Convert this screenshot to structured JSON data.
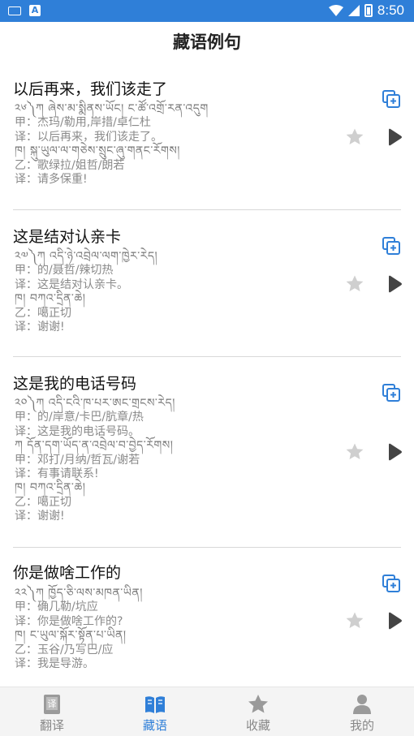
{
  "status": {
    "time": "8:50"
  },
  "header": {
    "title": "藏语例句"
  },
  "colors": {
    "accent": "#2f7fd8",
    "icon_gray": "#cfcfcf",
    "play": "#444444"
  },
  "entries": [
    {
      "title": "以后再来，我们该走了",
      "lines": [
        "༢༦༽ཀ  ཞེས་མ་སྨིནས་ཡོང།     ང་ཚོ་འགྲོ་རན་འདུག",
        "甲：杰玛/勒用,岸措/卓仁杜",
        "译：以后再来，我们该走了。",
        "ཁ།  སྐུ་ཡུལ་ལ་གཅེས་སྲུང་ཞུ་གནང་རོགས།",
        "乙：歌绿拉/姐哲/朗若",
        "译：请多保重!"
      ]
    },
    {
      "title": "这是结对认亲卡",
      "lines": [
        "༢༧༽ཀ  འདི་ཉེ་འབྲེལ་ལག་ཁྱེར་རེད།",
        "甲：的/聂哲/辣切热",
        "译：这是结对认亲卡。",
        "ཁ།  བཀའ་དྲིན་ཆེ།",
        "乙：噶正切",
        "译：谢谢!"
      ]
    },
    {
      "title": "这是我的电话号码",
      "lines": [
        "༢༠༽ཀ  འདི་ངའི་ཁ་པར་ཨང་གྲངས་རེད།",
        "甲：的/岸意/卡巴/肮章/热",
        "译：这是我的电话号码。",
        "ཀ  དོན་དག་ཡོད་ན་འབྲེལ་བ་བྱེད་རོགས།",
        "甲：邓打/月纳/哲瓦/谢若",
        "译：有事请联系!",
        "ཁ།  བཀའ་དྲིན་ཆེ།",
        "乙：噶正切",
        "译：谢谢!"
      ]
    },
    {
      "title": "你是做啥工作的",
      "lines": [
        "༢༢༽ཀ  ཁྱོད་ཅི་ལས་མཁན་ཡིན།",
        "甲：确几勒/坑应",
        "译：你是做啥工作的?",
        "ཁ།  ང་ཡུལ་སྐོར་སྟོན་པ་ཡིན།",
        "乙：玉谷/乃写巴/应",
        "译：我是导游。"
      ]
    }
  ],
  "nav": [
    {
      "label": "翻译",
      "icon": "book-translate-icon",
      "active": false
    },
    {
      "label": "藏语",
      "icon": "open-book-icon",
      "active": true
    },
    {
      "label": "收藏",
      "icon": "star-icon",
      "active": false
    },
    {
      "label": "我的",
      "icon": "person-icon",
      "active": false
    }
  ]
}
